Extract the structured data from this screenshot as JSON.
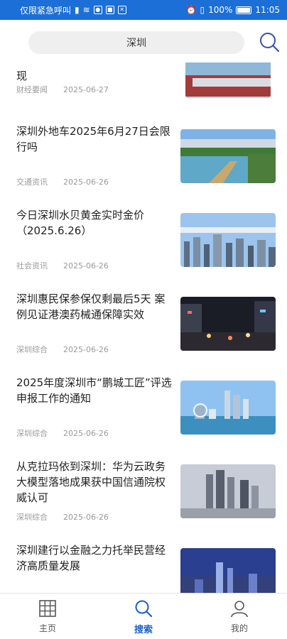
{
  "status_bar": {
    "carrier": "仅限紧急呼叫",
    "battery": "100%",
    "time": "11:05"
  },
  "search": {
    "value": "深圳"
  },
  "news": [
    {
      "title": "现",
      "source": "财经要闻",
      "date": "2025-06-27"
    },
    {
      "title": "深圳外地车2025年6月27日会限行吗",
      "source": "交通资讯",
      "date": "2025-06-26"
    },
    {
      "title": "今日深圳水贝黄金实时金价（2025.6.26）",
      "source": "社会资讯",
      "date": "2025-06-26"
    },
    {
      "title": "深圳惠民保参保仅剩最后5天 案例见证港澳药械通保障实效",
      "source": "深圳综合",
      "date": "2025-06-26"
    },
    {
      "title": "2025年度深圳市“鹏城工匠”评选申报工作的通知",
      "source": "深圳综合",
      "date": "2025-06-26"
    },
    {
      "title": "从克拉玛依到深圳：华为云政务大模型落地成果获中国信通院权威认可",
      "source": "深圳综合",
      "date": "2025-06-26"
    },
    {
      "title": "深圳建行以金融之力托举民营经济高质量发展",
      "source": "",
      "date": ""
    }
  ],
  "tabs": [
    {
      "label": "主页",
      "icon": "grid-icon"
    },
    {
      "label": "搜索",
      "icon": "search-icon"
    },
    {
      "label": "我的",
      "icon": "user-icon"
    }
  ],
  "colors": {
    "accent": "#1c5fc8",
    "status_bar": "#1c6fd6"
  }
}
